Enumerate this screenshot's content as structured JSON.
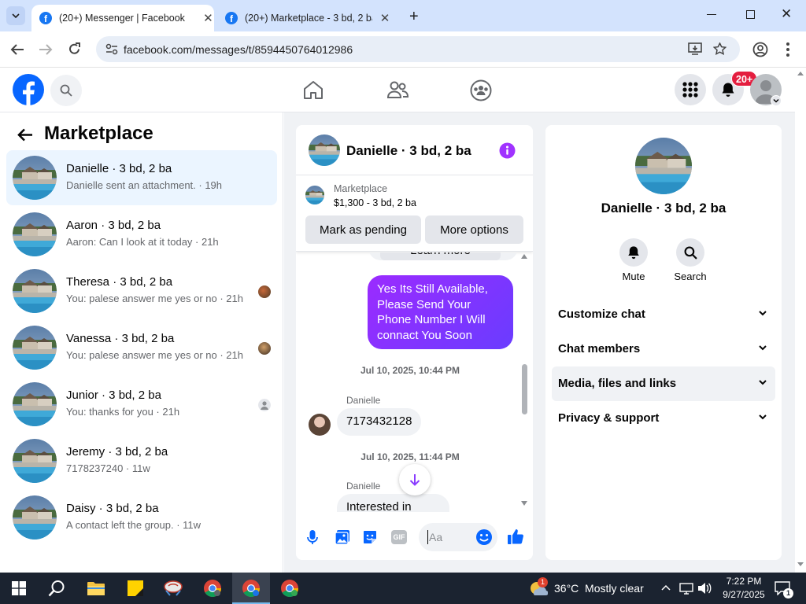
{
  "browser": {
    "tabs": [
      {
        "title": "(20+) Messenger | Facebook",
        "active": true
      },
      {
        "title": "(20+) Marketplace - 3 bd, 2 ba",
        "active": false
      }
    ],
    "url": "facebook.com/messages/t/8594450764012986"
  },
  "header": {
    "notifications_badge": "20+"
  },
  "sidebar": {
    "title": "Marketplace",
    "conversations": [
      {
        "name": "Danielle · 3 bd, 2 ba",
        "preview": "Danielle sent an attachment. · 19h",
        "selected": true
      },
      {
        "name": "Aaron · 3 bd, 2 ba",
        "preview": "Aaron: Can I look at it today · 21h"
      },
      {
        "name": "Theresa · 3 bd, 2 ba",
        "preview": "You: palese answer me yes or no · 21h"
      },
      {
        "name": "Vanessa · 3 bd, 2 ba",
        "preview": "You: palese answer me yes or no · 21h"
      },
      {
        "name": "Junior · 3 bd, 2 ba",
        "preview": "You: thanks for you · 21h"
      },
      {
        "name": "Jeremy · 3 bd, 2 ba",
        "preview": "7178237240 · 11w"
      },
      {
        "name": "Daisy · 3 bd, 2 ba",
        "preview": "A contact left the group. · 11w"
      }
    ]
  },
  "chat": {
    "title": "Danielle · 3 bd, 2 ba",
    "listing": {
      "source": "Marketplace",
      "price_title": "$1,300 - 3 bd, 2 ba",
      "pending_button": "Mark as pending",
      "options_button": "More options"
    },
    "messages": {
      "learn_more": "Learn more",
      "outgoing": "Yes Its Still Available, Please Send Your Phone Number I Will connact You Soon",
      "timestamp1": "Jul 10, 2025, 10:44 PM",
      "sender1": "Danielle",
      "incoming1": "7173432128",
      "timestamp2": "Jul 10, 2025, 11:44 PM",
      "sender2": "Danielle",
      "incoming2": "Interested in"
    },
    "composer_placeholder": "Aa",
    "gif_label": "GIF"
  },
  "details": {
    "name": "Danielle · 3 bd, 2 ba",
    "mute_label": "Mute",
    "search_label": "Search",
    "sections": [
      "Customize chat",
      "Chat members",
      "Media, files and links",
      "Privacy & support"
    ]
  },
  "taskbar": {
    "weather": "36°C  Mostly clear",
    "weather_badge": "1",
    "time": "7:22 PM",
    "date": "9/27/2025",
    "notification_count": "1"
  },
  "colors": {
    "facebook_blue": "#0866ff",
    "messenger_purple": "#a033ff",
    "selected_row": "#ebf5ff",
    "badge_red": "#e41e3f"
  }
}
